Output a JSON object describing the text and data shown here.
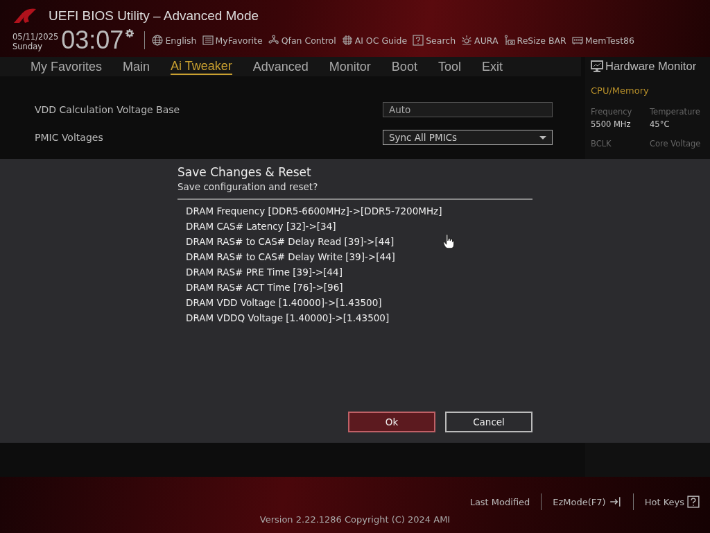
{
  "window": {
    "title": "UEFI BIOS Utility – Advanced Mode"
  },
  "clock": {
    "date": "05/11/2025",
    "day": "Sunday",
    "time": "03:07"
  },
  "toolbar": [
    {
      "label": "English",
      "kind": "globe"
    },
    {
      "label": "MyFavorite",
      "kind": "list"
    },
    {
      "label": "Qfan Control",
      "kind": "fan"
    },
    {
      "label": "AI OC Guide",
      "kind": "chip"
    },
    {
      "label": "Search",
      "kind": "help"
    },
    {
      "label": "AURA",
      "kind": "light"
    },
    {
      "label": "ReSize BAR",
      "kind": "card"
    },
    {
      "label": "MemTest86",
      "kind": "memory"
    }
  ],
  "tabs": [
    {
      "label": "My Favorites",
      "selected": false
    },
    {
      "label": "Main",
      "selected": false
    },
    {
      "label": "Ai Tweaker",
      "selected": true
    },
    {
      "label": "Advanced",
      "selected": false
    },
    {
      "label": "Monitor",
      "selected": false
    },
    {
      "label": "Boot",
      "selected": false
    },
    {
      "label": "Tool",
      "selected": false
    },
    {
      "label": "Exit",
      "selected": false
    }
  ],
  "settings": [
    {
      "label": "VDD Calculation Voltage Base",
      "value": "Auto",
      "kind": "field"
    },
    {
      "label": "PMIC Voltages",
      "value": "Sync All PMICs",
      "kind": "dropdown"
    }
  ],
  "hardware_monitor": {
    "title": "Hardware Monitor",
    "section": "CPU/Memory",
    "readings": [
      {
        "label": "Frequency",
        "value": "5500 MHz"
      },
      {
        "label": "Temperature",
        "value": "45°C"
      },
      {
        "label": "BCLK"
      },
      {
        "label": "Core Voltage"
      }
    ]
  },
  "dialog": {
    "title": "Save Changes & Reset",
    "subtitle": "Save configuration and reset?",
    "changes": [
      "DRAM Frequency [DDR5-6600MHz]->[DDR5-7200MHz]",
      "DRAM CAS# Latency [32]->[34]",
      "DRAM RAS# to CAS# Delay Read [39]->[44]",
      "DRAM RAS# to CAS# Delay Write [39]->[44]",
      "DRAM RAS# PRE Time [39]->[44]",
      "DRAM RAS# ACT Time [76]->[96]",
      "DRAM VDD Voltage [1.40000]->[1.43500]",
      "DRAM VDDQ Voltage [1.40000]->[1.43500]"
    ],
    "buttons": [
      {
        "label": "Ok",
        "selected": true
      },
      {
        "label": "Cancel",
        "selected": false
      }
    ]
  },
  "footer": {
    "actions": [
      {
        "label": "Last Modified"
      },
      {
        "label": "EzMode(F7)",
        "kind": "exit"
      },
      {
        "label": "Hot Keys",
        "kind": "help"
      }
    ],
    "version": "Version 2.22.1286 Copyright (C) 2024 AMI"
  }
}
